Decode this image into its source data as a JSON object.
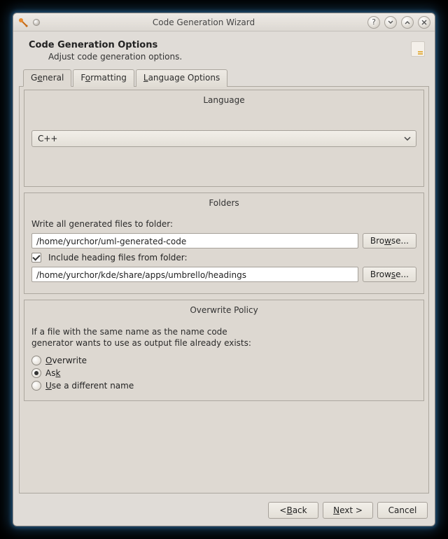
{
  "window": {
    "title": "Code Generation Wizard"
  },
  "header": {
    "title": "Code Generation Options",
    "subtitle": "Adjust code generation options."
  },
  "tabs": {
    "general_pre": "G",
    "general_ul": "e",
    "general_post": "neral",
    "formatting_pre": "F",
    "formatting_ul": "o",
    "formatting_post": "rmatting",
    "langopts_pre": "",
    "langopts_ul": "L",
    "langopts_post": "anguage Options"
  },
  "language": {
    "group_title": "Language",
    "selected": "C++"
  },
  "folders": {
    "group_title": "Folders",
    "write_label": "Write all generated files to folder:",
    "output_path": "/home/yurchor/uml-generated-code",
    "include_label": "Include heading files from folder:",
    "headings_path": "/home/yurchor/kde/share/apps/umbrello/headings",
    "browse_pre": "Bro",
    "browse_ul": "w",
    "browse_post": "se...",
    "browse2_pre": "Brow",
    "browse2_ul": "s",
    "browse2_post": "e...",
    "include_checked": true
  },
  "policy": {
    "group_title": "Overwrite Policy",
    "text1": "If a file with the same name as the name code",
    "text2": "generator wants to use as output file already exists:",
    "opt_overwrite_pre": "",
    "opt_overwrite_ul": "O",
    "opt_overwrite_post": "verwrite",
    "opt_ask_pre": "As",
    "opt_ask_ul": "k",
    "opt_ask_post": "",
    "opt_diff_pre": "",
    "opt_diff_ul": "U",
    "opt_diff_post": "se a different name",
    "selected": "ask"
  },
  "footer": {
    "back_pre": "< ",
    "back_ul": "B",
    "back_post": "ack",
    "next_pre": "",
    "next_ul": "N",
    "next_post": "ext >",
    "cancel": "Cancel"
  }
}
